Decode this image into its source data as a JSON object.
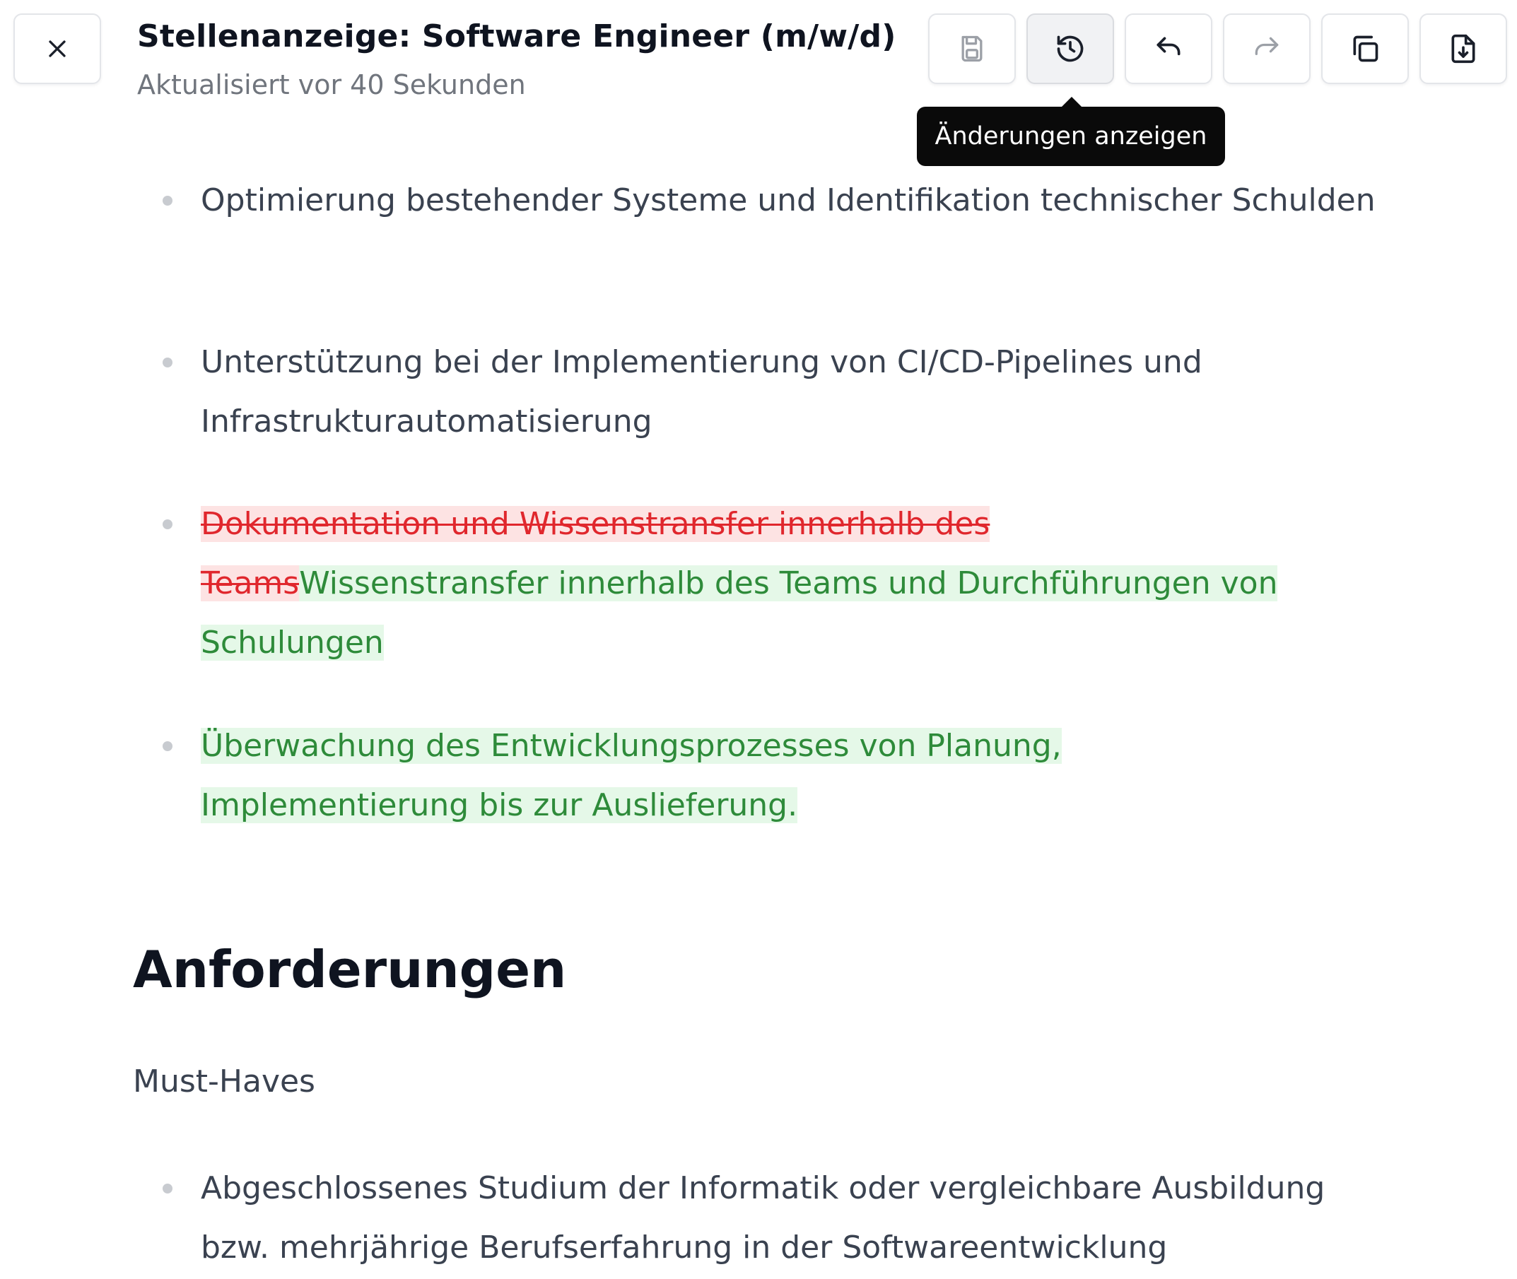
{
  "header": {
    "title": "Stellenanzeige: Software Engineer (m/w/d)",
    "subtitle": "Aktualisiert vor 40 Sekunden",
    "close_icon": "close-icon"
  },
  "toolbar": {
    "buttons": [
      {
        "name": "save-button",
        "icon": "save-icon",
        "enabled": false
      },
      {
        "name": "history-button",
        "icon": "history-icon",
        "active": true
      },
      {
        "name": "undo-button",
        "icon": "undo-icon",
        "enabled": true
      },
      {
        "name": "redo-button",
        "icon": "redo-icon",
        "enabled": false
      },
      {
        "name": "copy-button",
        "icon": "copy-icon",
        "enabled": true
      },
      {
        "name": "download-button",
        "icon": "file-download-icon",
        "enabled": true
      }
    ],
    "tooltip": "Änderungen anzeigen"
  },
  "content": {
    "bullets": [
      {
        "text": "Optimierung bestehender Systeme und Identifikation technischer Schulden"
      },
      {
        "text": "Unterstützung bei der Implementierung von CI/CD-Pipelines und Infrastrukturautomatisierung"
      },
      {
        "deleted": "Dokumentation und Wissenstransfer innerhalb des Teams",
        "inserted": "Wissenstransfer innerhalb des Teams und Durchführungen von Schulungen"
      },
      {
        "inserted": "Überwachung des Entwicklungsprozesses von Planung, Implementierung bis zur Auslieferung."
      }
    ],
    "section_heading": "Anforderungen",
    "sub_heading": "Must-Haves",
    "requirements": [
      {
        "text": "Abgeschlossenes Studium der Informatik oder vergleichbare Ausbildung bzw. mehrjährige Berufserfahrung in der Softwareentwicklung"
      }
    ]
  },
  "colors": {
    "deleted_text": "#e0272d",
    "deleted_bg": "#fde3e3",
    "inserted_text": "#2e8b3a",
    "inserted_bg": "#e5f8e8"
  }
}
